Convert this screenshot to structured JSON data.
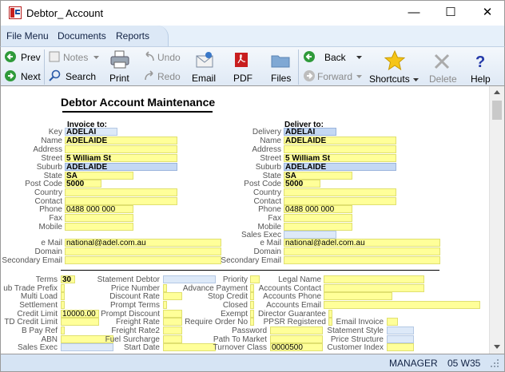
{
  "window": {
    "title": "Debtor_ Account",
    "minimize_glyph": "—",
    "maximize_glyph": "☐",
    "close_glyph": "✕"
  },
  "menu": {
    "file": "File Menu",
    "documents": "Documents",
    "reports": "Reports"
  },
  "toolbar": {
    "prev": "Prev",
    "next": "Next",
    "notes": "Notes",
    "search": "Search",
    "undo": "Undo",
    "redo": "Redo",
    "print": "Print",
    "email": "Email",
    "pdf": "PDF",
    "files": "Files",
    "back": "Back",
    "forward": "Forward",
    "shortcuts": "Shortcuts",
    "delete": "Delete",
    "help": "Help"
  },
  "form": {
    "heading": "Debtor Account Maintenance",
    "invoice_to": "Invoice to:",
    "deliver_to": "Deliver to:",
    "labels": {
      "key": "Key",
      "name": "Name",
      "address": "Address",
      "street": "Street",
      "suburb": "Suburb",
      "state": "State",
      "post_code": "Post Code",
      "country": "Country",
      "contact": "Contact",
      "phone": "Phone",
      "fax": "Fax",
      "mobile": "Mobile",
      "email": "e Mail",
      "domain": "Domain",
      "secondary_email": "Secondary Email",
      "delivery": "Delivery",
      "sales_exec": "Sales Exec"
    },
    "invoice": {
      "key": "ADELAI",
      "name": "ADELAIDE",
      "address": "",
      "street": "5 William  St",
      "suburb": "ADELAIDE",
      "state": "SA",
      "post_code": "5000",
      "country": "",
      "contact": "",
      "phone": "0488 000 000",
      "fax": "",
      "mobile": "",
      "email": "national@adel.com.au",
      "domain": "",
      "secondary_email": ""
    },
    "delivery": {
      "key": "ADELAI",
      "name": "ADELAIDE",
      "address": "",
      "street": "5 William  St",
      "suburb": "ADELAIDE",
      "state": "SA",
      "post_code": "5000",
      "country": "",
      "contact": "",
      "phone": "0488 000 000",
      "fax": "",
      "mobile": "",
      "sales_exec": "",
      "email": "national@adel.com.au",
      "domain": "",
      "secondary_email": ""
    },
    "terms": {
      "c1": [
        "Terms",
        "ub Trade Prefix",
        "Multi Load",
        "Settlement",
        "Credit Limit",
        "TD Credit Limit",
        "B Pay Ref",
        "ABN",
        "Sales Exec"
      ],
      "c1_values": [
        "30",
        "",
        "",
        "",
        "10000.00",
        "",
        "",
        "",
        ""
      ],
      "c2": [
        "Statement Debtor",
        "Price Number",
        "Discount Rate",
        "Prompt Terms",
        "Prompt Discount",
        "Freight Rate",
        "Freight Rate2",
        "Fuel Surcharge",
        "Start Date"
      ],
      "c3": [
        "Priority",
        "Advance Payment",
        "Stop Credit",
        "Closed",
        "Exempt",
        "Require Order No",
        "Password",
        "Path To Market",
        "Turnover Class"
      ],
      "c3_turnover": "0000500",
      "c4": [
        "Legal Name",
        "Accounts Contact",
        "Accounts Phone",
        "Accounts Email",
        "Director Guarantee",
        "PPSR Registered",
        "",
        "",
        ""
      ],
      "c5": [
        "Email Invoice",
        "Statement Style",
        "Price Structure",
        "Customer Index"
      ]
    }
  },
  "status": {
    "user": "MANAGER",
    "code": "05 W35"
  }
}
